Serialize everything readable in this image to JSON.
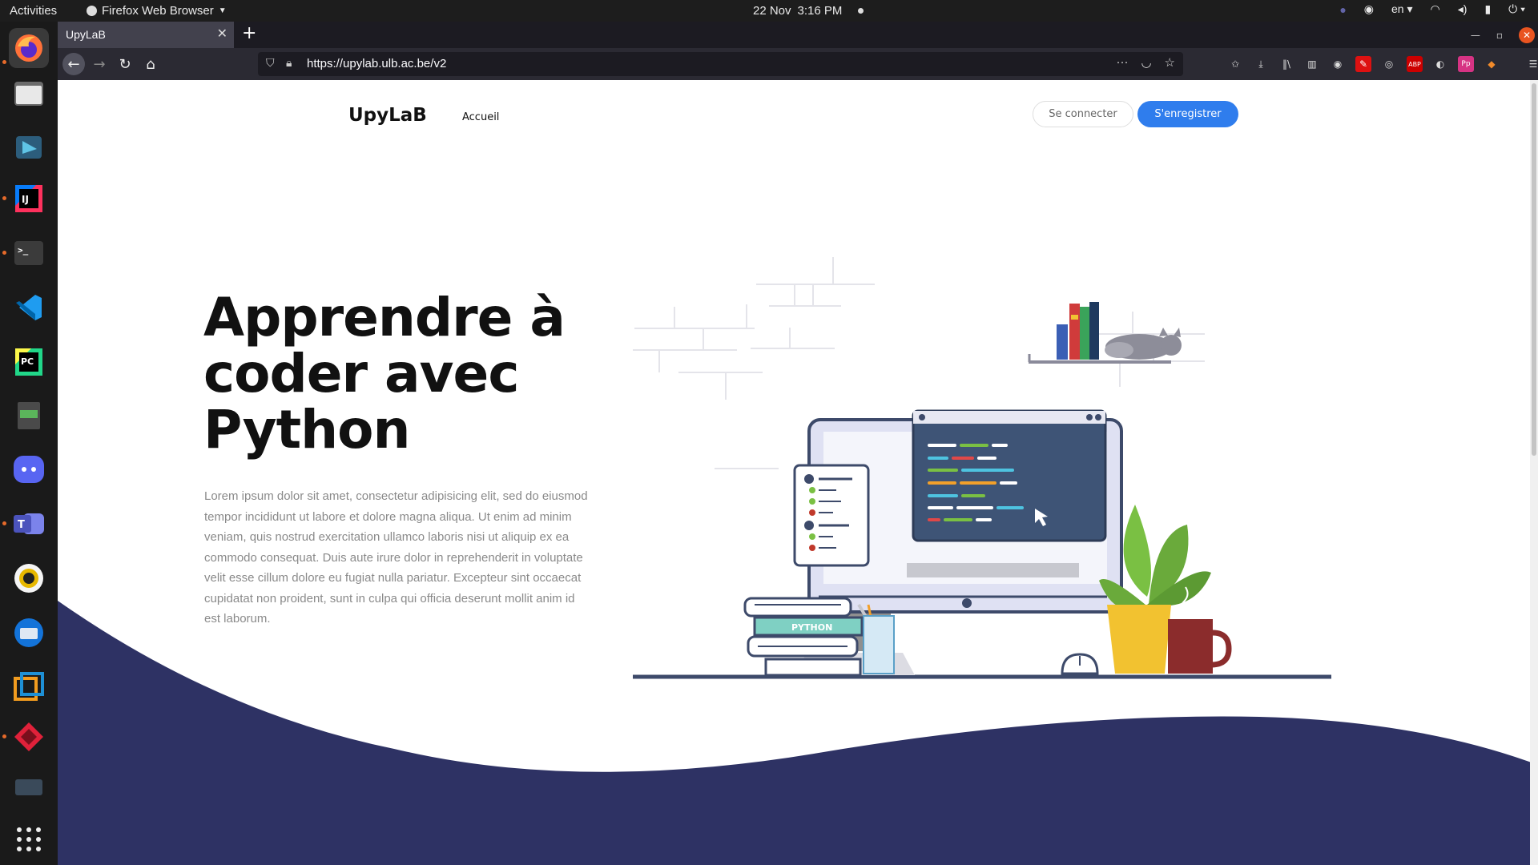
{
  "topbar": {
    "activities": "Activities",
    "app_name": "Firefox Web Browser",
    "date": "22 Nov",
    "time": "3:16 PM",
    "lang": "en"
  },
  "dock": {
    "apps": [
      "firefox",
      "files",
      "snap-store",
      "intellij-idea",
      "terminal",
      "vscode",
      "pycharm",
      "notes",
      "discord",
      "teams",
      "rhythmbox",
      "thunderbird",
      "virtualbox",
      "git-client",
      "show-applications"
    ]
  },
  "browser": {
    "tab_title": "UpyLaB",
    "url": "https://upylab.ulb.ac.be/v2"
  },
  "page": {
    "brand": "UpyLaB",
    "nav_home": "Accueil",
    "login": "Se connecter",
    "register": "S'enregistrer",
    "hero_title": "Apprendre à coder avec Python",
    "hero_text": "Lorem ipsum dolor sit amet, consectetur adipisicing elit, sed do eiusmod tempor incididunt ut labore et dolore magna aliqua. Ut enim ad minim veniam, quis nostrud exercitation ullamco laboris nisi ut aliquip ex ea commodo consequat. Duis aute irure dolor in reprehenderit in voluptate velit esse cillum dolore eu fugiat nulla pariatur. Excepteur sint occaecat cupidatat non proident, sunt in culpa qui officia deserunt mollit anim id est laborum.",
    "book_label": "PYTHON"
  },
  "colors": {
    "accent_blue": "#2f7ded",
    "wave_navy": "#2e3264",
    "firefox_dark": "#2b2a33"
  }
}
